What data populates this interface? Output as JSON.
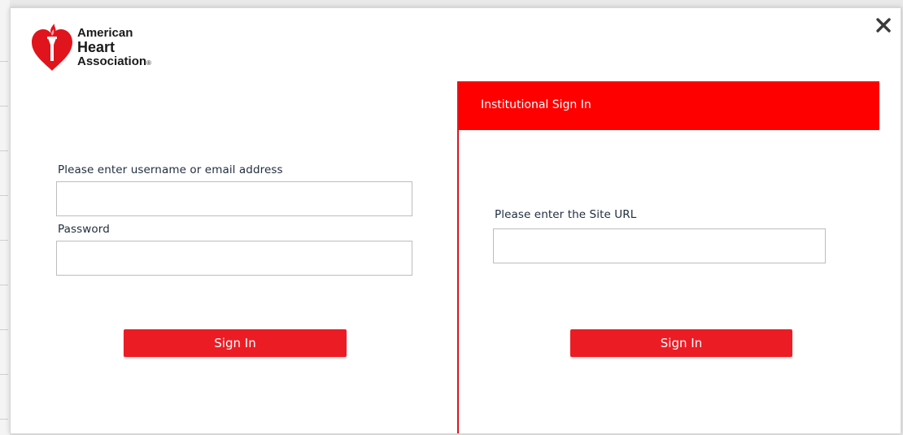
{
  "brand": {
    "line1": "American",
    "line2": "Heart",
    "line3": "Association",
    "registered": "®",
    "red": "#e0141c"
  },
  "close_icon": "close-icon",
  "left_form": {
    "username_label": "Please enter username or email address",
    "username_value": "",
    "password_label": "Password",
    "password_value": "",
    "signin_label": "Sign In"
  },
  "institutional": {
    "header": "Institutional Sign In",
    "site_url_label": "Please enter the Site URL",
    "site_url_value": "",
    "signin_label": "Sign In",
    "header_color": "#ff0000"
  },
  "colors": {
    "button": "#ec1c24",
    "label_text": "#1f2d3d"
  }
}
